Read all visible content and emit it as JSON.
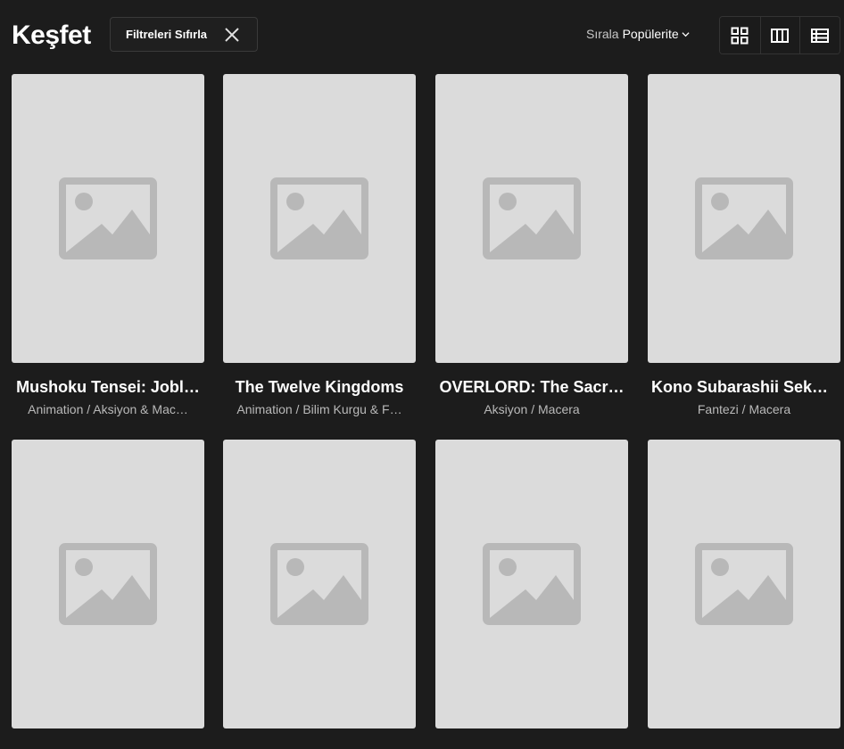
{
  "header": {
    "title": "Keşfet",
    "reset_filters_label": "Filtreleri Sıfırla",
    "sort_label": "Sırala",
    "sort_value": "Popülerite",
    "view_modes": [
      "grid-icon",
      "columns-icon",
      "list-icon"
    ]
  },
  "cards": [
    {
      "title": "Mushoku Tensei: Jobl…",
      "genres": "Animation  /  Aksiyon & Mac…"
    },
    {
      "title": "The Twelve Kingdoms",
      "genres": "Animation  /  Bilim Kurgu & F…"
    },
    {
      "title": "OVERLORD: The Sacr…",
      "genres": "Aksiyon  /  Macera"
    },
    {
      "title": "Kono Subarashii Seka…",
      "genres": "Fantezi  /  Macera"
    },
    {
      "title": "",
      "genres": ""
    },
    {
      "title": "",
      "genres": ""
    },
    {
      "title": "",
      "genres": ""
    },
    {
      "title": "",
      "genres": ""
    }
  ],
  "colors": {
    "background": "#1c1c1c",
    "poster_placeholder": "#dbdbdb",
    "placeholder_icon": "#b8b8b8"
  }
}
